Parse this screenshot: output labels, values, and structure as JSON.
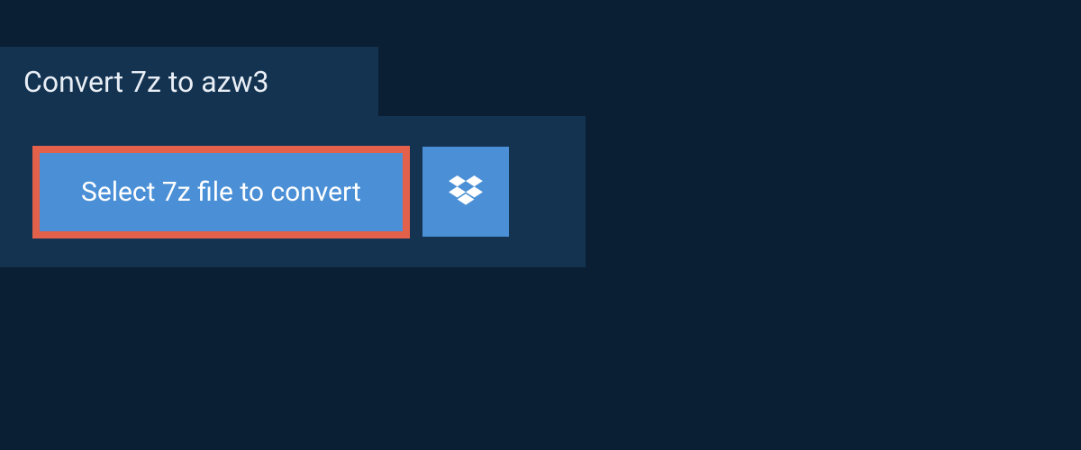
{
  "header": {
    "title": "Convert 7z to azw3"
  },
  "main": {
    "select_button_label": "Select 7z file to convert"
  },
  "colors": {
    "bg_dark": "#0a1f33",
    "panel": "#143351",
    "button_blue": "#4b90d6",
    "highlight_border": "#e3604a",
    "text_light": "#e8eef5",
    "white": "#ffffff"
  }
}
